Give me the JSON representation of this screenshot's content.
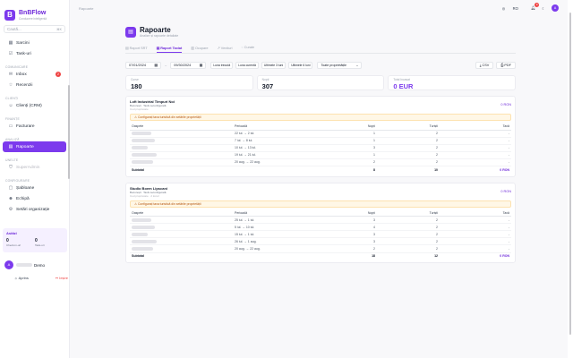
{
  "app": {
    "name": "BnBFlow",
    "tagline": "Conducere inteligentă",
    "logo": "B"
  },
  "search": {
    "placeholder": "Caută...",
    "shortcut": "⌘K"
  },
  "sidebar": {
    "top_item": {
      "label": "Sarcini",
      "icon": "grid-icon"
    },
    "item_tasks": {
      "label": "Task-uri",
      "icon": "checklist-icon"
    },
    "group_comm": "COMUNICARE",
    "item_inbox": {
      "label": "Inbox",
      "icon": "inbox-icon",
      "badge": "2"
    },
    "item_reviews": {
      "label": "Recenzii",
      "icon": "star-icon"
    },
    "group_clients": "CLIENȚI",
    "item_crm": {
      "label": "Clienți (CRM)",
      "icon": "users-icon"
    },
    "group_fin": "FINANȚE",
    "item_invoices": {
      "label": "Facturare",
      "icon": "receipt-icon"
    },
    "group_analysis": "ANALIZĂ",
    "item_reports": {
      "label": "Rapoarte",
      "icon": "chart-icon"
    },
    "group_tools": "UNELTE",
    "item_superofficer": {
      "label": "SuperAdmin",
      "icon": "shield-icon"
    },
    "group_settings": "CONFIGURARE",
    "item_templates": {
      "label": "Șabloane",
      "icon": "template-icon"
    },
    "item_team": {
      "label": "Echipă",
      "icon": "team-icon"
    },
    "item_org": {
      "label": "Setări organizație",
      "icon": "gear-icon"
    }
  },
  "activity": {
    "title": "Astăzi",
    "a_value": "0",
    "a_label": "Check-in-uri",
    "b_value": "0",
    "b_label": "Task-uri"
  },
  "user": {
    "initial": "A",
    "name": "Demo"
  },
  "footer": {
    "theme": "Aprins",
    "logout": "Ieșire"
  },
  "topbar": {
    "crumb": "Rapoarte",
    "lang": "RO",
    "notif_count": "9",
    "avatar": "A"
  },
  "page": {
    "icon": "▤",
    "title": "Rapoarte",
    "subtitle": "Analize și rapoarte detaliate"
  },
  "tabs": [
    "Raport SRT",
    "Raport Taxiat",
    "Ocupare",
    "Venituri",
    "Curate"
  ],
  "filters": {
    "from": "07/01/2024",
    "to": "09/30/2024",
    "chips": [
      "Luna trecută",
      "Luna curentă",
      "Ultimele 3 luni",
      "Ultimele 6 luni"
    ],
    "select": "Toate proprietățile",
    "csv": "CSV",
    "pdf": "PDF"
  },
  "stats": [
    {
      "label": "Curse",
      "value": "180"
    },
    {
      "label": "Nopți",
      "value": "307"
    },
    {
      "label": "Total încasat",
      "value": "0 EUR"
    }
  ],
  "table_headers": [
    "Oaspete",
    "Perioadă",
    "Nopți",
    "Turiști",
    "Taxă"
  ],
  "cards": [
    {
      "title": "Loft Industrial Timpuri Noi",
      "sub": "București · Taxă neconfigurată",
      "extra": "Cod proprietate",
      "right": "0 RON",
      "warning": "⚠ Configurați taxa turistică din setările proprietății",
      "rows": [
        {
          "period": "22 iul. → 2 iul.",
          "nights": "1",
          "tourists": "2",
          "tax": "-"
        },
        {
          "period": "7 iul. → 8 iul.",
          "nights": "1",
          "tourists": "2",
          "tax": "-"
        },
        {
          "period": "10 iul. → 13 iul.",
          "nights": "3",
          "tourists": "2",
          "tax": "-"
        },
        {
          "period": "19 iul. → 21 iul.",
          "nights": "1",
          "tourists": "2",
          "tax": "-"
        },
        {
          "period": "20 aug. → 22 aug.",
          "nights": "2",
          "tourists": "2",
          "tax": "-"
        }
      ],
      "subtotal": {
        "label": "Subtotal",
        "nights": "8",
        "tourists": "10",
        "tax": "0 RON"
      }
    },
    {
      "title": "Studio Boem Lipscani",
      "sub": "București · Taxă neconfigurată",
      "extra": "Cod proprietate · 2 locuri",
      "right": "0 RON",
      "warning": "⚠ Configurați taxa turistică din setările proprietății",
      "rows": [
        {
          "period": "25 iul. → 1 iul.",
          "nights": "3",
          "tourists": "2",
          "tax": "-"
        },
        {
          "period": "5 iul. → 10 iul.",
          "nights": "4",
          "tourists": "2",
          "tax": "-"
        },
        {
          "period": "15 iul. → 1 iul.",
          "nights": "3",
          "tourists": "2",
          "tax": "-"
        },
        {
          "period": "26 iul. → 1 aug.",
          "nights": "3",
          "tourists": "2",
          "tax": "-"
        },
        {
          "period": "20 aug. → 22 aug.",
          "nights": "2",
          "tourists": "2",
          "tax": "-"
        }
      ],
      "subtotal": {
        "label": "Subtotal",
        "nights": "18",
        "tourists": "12",
        "tax": "0 RON"
      }
    }
  ]
}
